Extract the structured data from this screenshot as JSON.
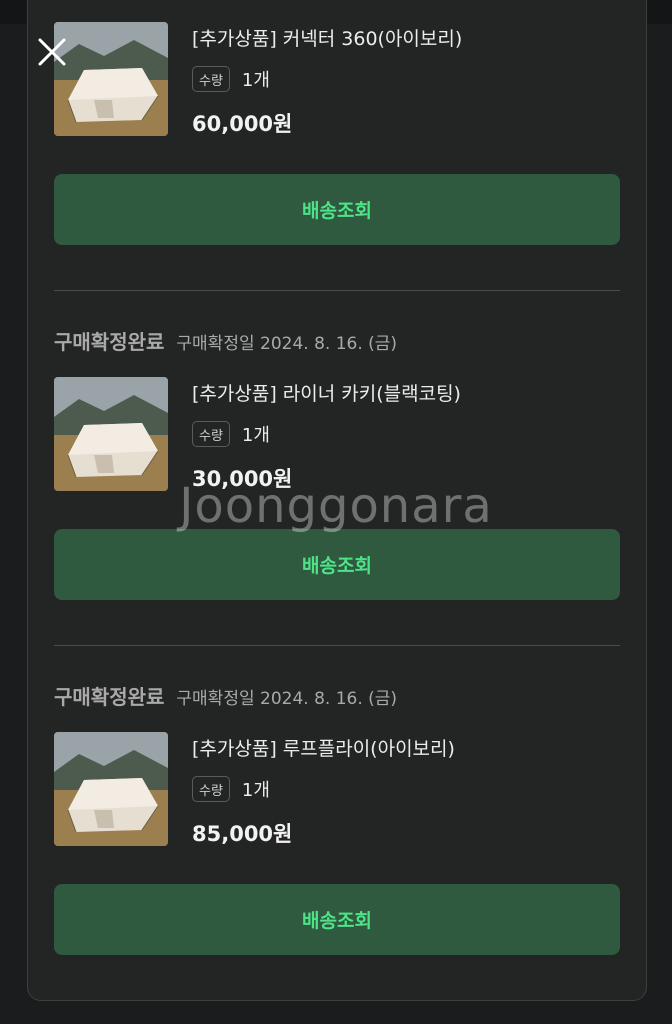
{
  "close_icon": "close-icon",
  "watermark": "Joonggonara",
  "colors": {
    "background": "#1b1c1d",
    "card": "#232524",
    "button_bg": "#2f5a40",
    "button_text": "#4fe388"
  },
  "orders": [
    {
      "status": "",
      "date": "",
      "product_name": "[추가상품] 커넥터 360(아이보리)",
      "qty_label": "수량",
      "qty_value": "1개",
      "price": "60,000원",
      "button_label": "배송조회"
    },
    {
      "status": "구매확정완료",
      "date": "구매확정일 2024. 8. 16. (금)",
      "product_name": "[추가상품] 라이너 카키(블랙코팅)",
      "qty_label": "수량",
      "qty_value": "1개",
      "price": "30,000원",
      "button_label": "배송조회"
    },
    {
      "status": "구매확정완료",
      "date": "구매확정일 2024. 8. 16. (금)",
      "product_name": "[추가상품] 루프플라이(아이보리)",
      "qty_label": "수량",
      "qty_value": "1개",
      "price": "85,000원",
      "button_label": "배송조회"
    }
  ]
}
